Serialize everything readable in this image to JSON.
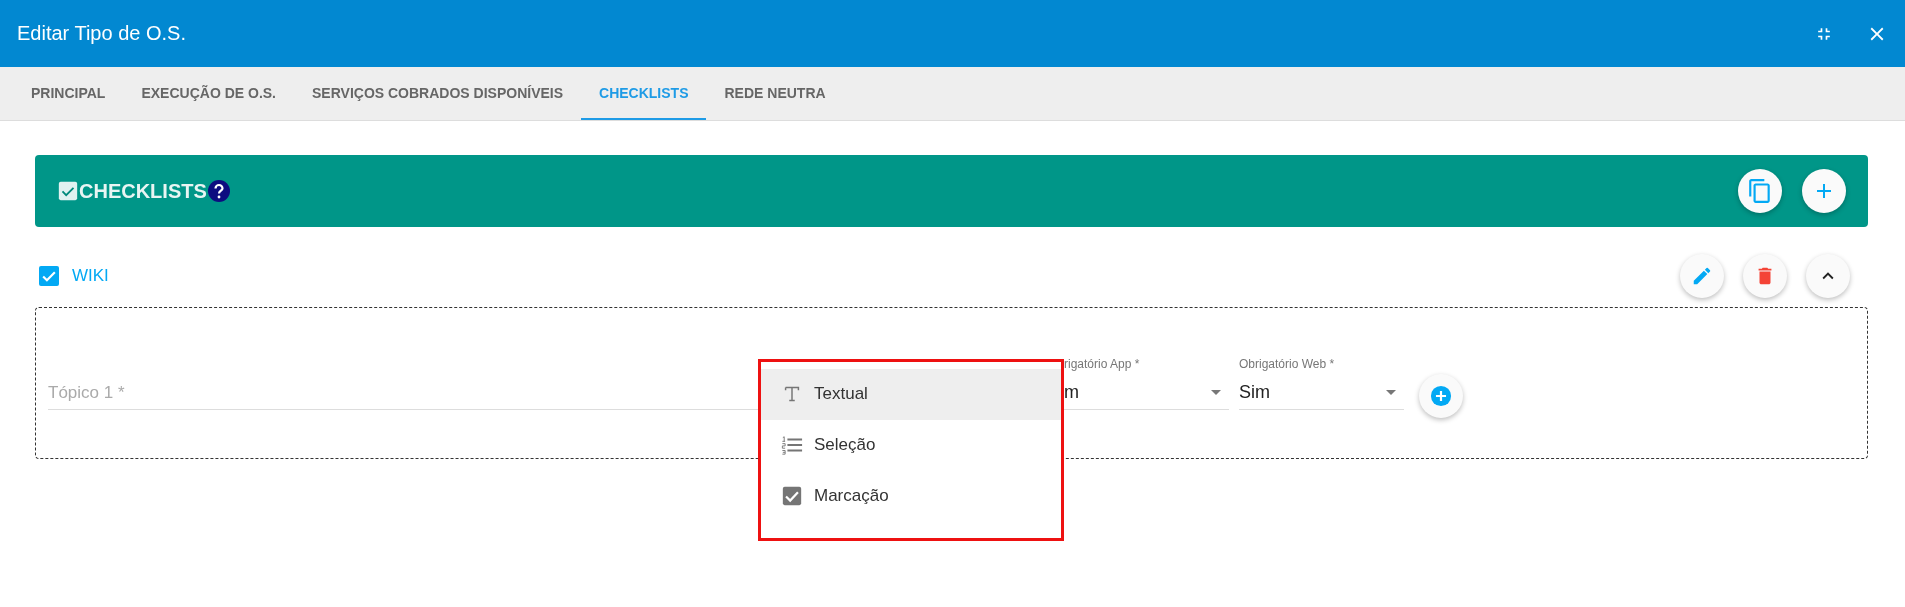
{
  "window": {
    "title": "Editar Tipo de O.S."
  },
  "tabs": [
    {
      "label": "PRINCIPAL",
      "selected": false
    },
    {
      "label": "EXECUÇÃO DE O.S.",
      "selected": false
    },
    {
      "label": "SERVIÇOS COBRADOS DISPONÍVEIS",
      "selected": false
    },
    {
      "label": "CHECKLISTS",
      "selected": true
    },
    {
      "label": "REDE NEUTRA",
      "selected": false
    }
  ],
  "section": {
    "title": "CHECKLISTS"
  },
  "checklist": {
    "label": "WIKI",
    "checked": true,
    "topic_field": {
      "placeholder": "Tópico 1 *"
    },
    "selects": [
      {
        "label": "rigatório App *",
        "value": "m"
      },
      {
        "label": "Obrigatório Web *",
        "value": "Sim"
      }
    ]
  },
  "menu": {
    "items": [
      {
        "label": "Textual",
        "kind": "text",
        "selected": true
      },
      {
        "label": "Seleção",
        "kind": "list",
        "selected": false
      },
      {
        "label": "Marcação",
        "kind": "check",
        "selected": false
      }
    ]
  }
}
